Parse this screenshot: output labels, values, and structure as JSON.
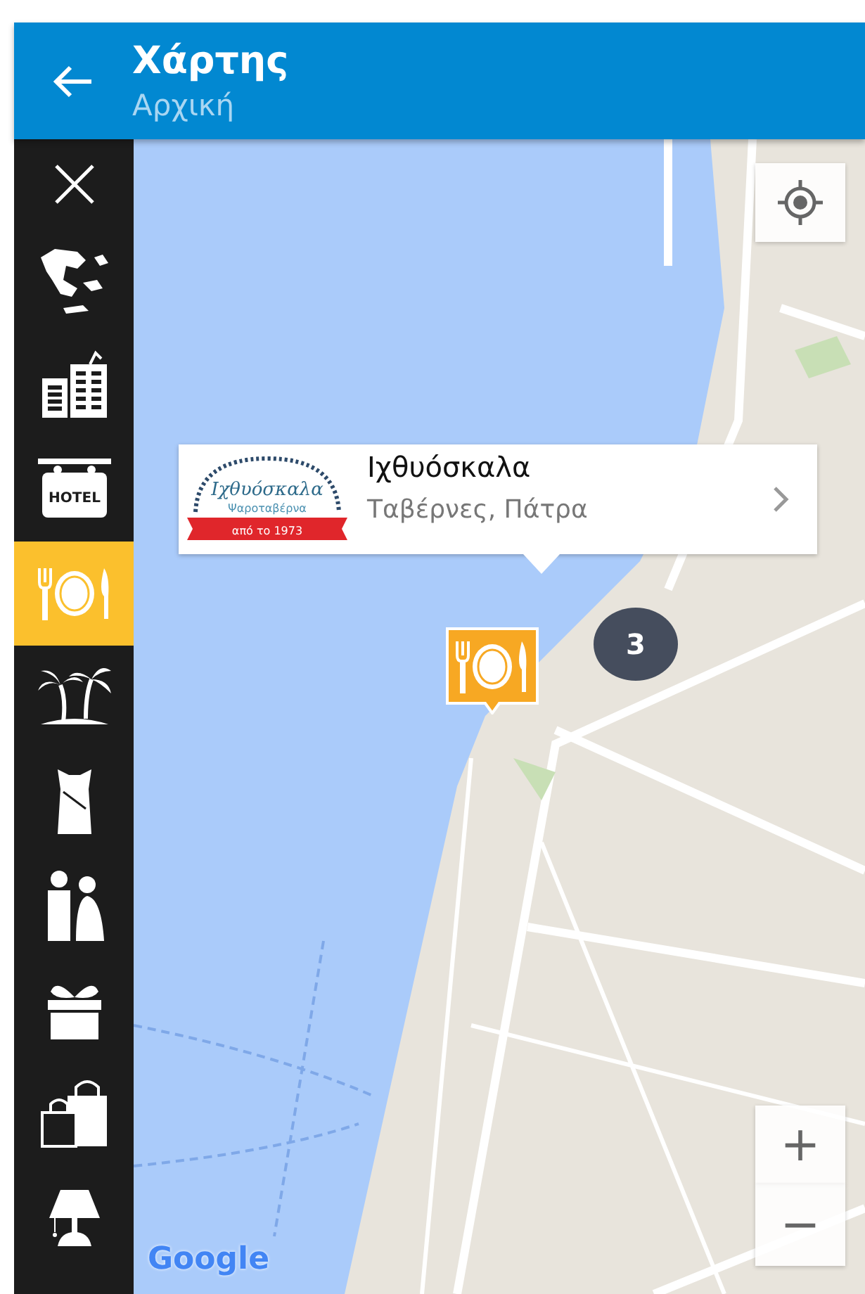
{
  "header": {
    "title": "Χάρτης",
    "subtitle": "Αρχική"
  },
  "sidebar": {
    "items": [
      {
        "kind": "close",
        "selected": false
      },
      {
        "kind": "greece",
        "selected": false
      },
      {
        "kind": "buildings",
        "selected": false
      },
      {
        "kind": "hotel",
        "label": "HOTEL",
        "selected": false
      },
      {
        "kind": "restaurant",
        "selected": true
      },
      {
        "kind": "island",
        "selected": false
      },
      {
        "kind": "dress",
        "selected": false
      },
      {
        "kind": "wedding",
        "selected": false
      },
      {
        "kind": "gift",
        "selected": false
      },
      {
        "kind": "shopping",
        "selected": false
      },
      {
        "kind": "lamp",
        "selected": false
      }
    ]
  },
  "popup": {
    "title": "Ιχθυόσκαλα",
    "subtitle": "Ταβέρνες, Πάτρα",
    "logo": {
      "name": "Ιχθυόσκαλα",
      "tagline": "Ψαροταβέρνα",
      "since": "από το 1973"
    }
  },
  "cluster": {
    "count": "3"
  },
  "zoom": {
    "in": "+",
    "out": "−"
  },
  "attribution": "Google"
}
